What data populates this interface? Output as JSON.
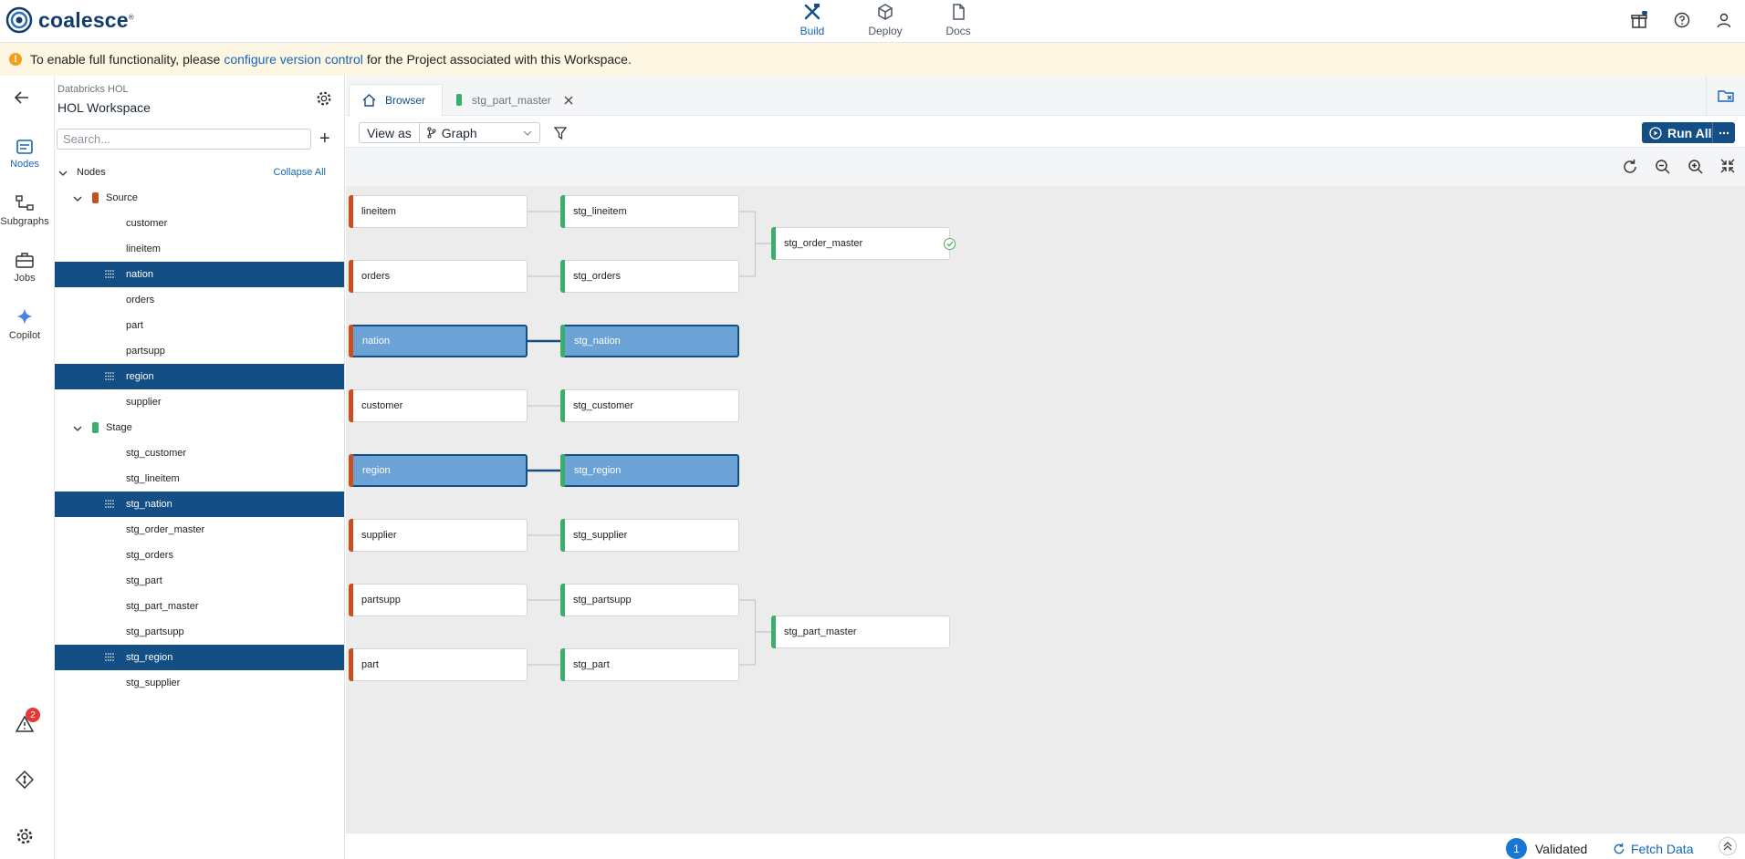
{
  "app": {
    "logo_text": "coalesce",
    "logo_mark": "®"
  },
  "top_nav": [
    {
      "label": "Build",
      "icon": "build-tools-icon",
      "active": true
    },
    {
      "label": "Deploy",
      "icon": "deploy-cube-icon",
      "active": false
    },
    {
      "label": "Docs",
      "icon": "docs-icon",
      "active": false
    }
  ],
  "banner": {
    "icon": "!",
    "text_before": "To enable full functionality, please",
    "link": "configure version control",
    "text_after": "for the Project associated with this Workspace."
  },
  "rail": {
    "items": [
      {
        "label": "Nodes",
        "active": true
      },
      {
        "label": "Subgraphs",
        "active": false
      },
      {
        "label": "Jobs",
        "active": false
      },
      {
        "label": "Copilot",
        "active": false
      }
    ],
    "alert_count": "2"
  },
  "workspace": {
    "org": "Databricks HOL",
    "name": "HOL Workspace"
  },
  "search": {
    "placeholder": "Search..."
  },
  "tree": {
    "root": "Nodes",
    "collapse_all": "Collapse All",
    "groups": [
      {
        "name": "Source",
        "color": "#c9501c",
        "items": [
          {
            "name": "customer",
            "selected": false
          },
          {
            "name": "lineitem",
            "selected": false
          },
          {
            "name": "nation",
            "selected": true
          },
          {
            "name": "orders",
            "selected": false
          },
          {
            "name": "part",
            "selected": false
          },
          {
            "name": "partsupp",
            "selected": false
          },
          {
            "name": "region",
            "selected": true
          },
          {
            "name": "supplier",
            "selected": false
          }
        ]
      },
      {
        "name": "Stage",
        "color": "#3cae6c",
        "items": [
          {
            "name": "stg_customer",
            "selected": false
          },
          {
            "name": "stg_lineitem",
            "selected": false
          },
          {
            "name": "stg_nation",
            "selected": true
          },
          {
            "name": "stg_order_master",
            "selected": false
          },
          {
            "name": "stg_orders",
            "selected": false
          },
          {
            "name": "stg_part",
            "selected": false
          },
          {
            "name": "stg_part_master",
            "selected": false
          },
          {
            "name": "stg_partsupp",
            "selected": false
          },
          {
            "name": "stg_region",
            "selected": true
          },
          {
            "name": "stg_supplier",
            "selected": false
          }
        ]
      }
    ]
  },
  "tabs": [
    {
      "label": "Browser",
      "active": true
    },
    {
      "label": "stg_part_master",
      "active": false,
      "color": "#3cae6c"
    }
  ],
  "toolbar": {
    "view_as_label": "View as",
    "view_as_value": "Graph",
    "run_all": "Run All"
  },
  "graph": {
    "colors": {
      "source": "#c9501c",
      "stage": "#3cae6c",
      "selected_fill": "#6ba3d6",
      "selected_border": "#134e85"
    },
    "nodes": [
      {
        "id": "lineitem",
        "label": "lineitem",
        "kind": "source",
        "selected": false
      },
      {
        "id": "stg_lineitem",
        "label": "stg_lineitem",
        "kind": "stage",
        "selected": false
      },
      {
        "id": "stg_order_master",
        "label": "stg_order_master",
        "kind": "stage",
        "selected": false,
        "validated": true
      },
      {
        "id": "orders",
        "label": "orders",
        "kind": "source",
        "selected": false
      },
      {
        "id": "stg_orders",
        "label": "stg_orders",
        "kind": "stage",
        "selected": false
      },
      {
        "id": "nation",
        "label": "nation",
        "kind": "source",
        "selected": true
      },
      {
        "id": "stg_nation",
        "label": "stg_nation",
        "kind": "stage",
        "selected": true
      },
      {
        "id": "customer",
        "label": "customer",
        "kind": "source",
        "selected": false
      },
      {
        "id": "stg_customer",
        "label": "stg_customer",
        "kind": "stage",
        "selected": false
      },
      {
        "id": "region",
        "label": "region",
        "kind": "source",
        "selected": true
      },
      {
        "id": "stg_region",
        "label": "stg_region",
        "kind": "stage",
        "selected": true
      },
      {
        "id": "supplier",
        "label": "supplier",
        "kind": "source",
        "selected": false
      },
      {
        "id": "stg_supplier",
        "label": "stg_supplier",
        "kind": "stage",
        "selected": false
      },
      {
        "id": "partsupp",
        "label": "partsupp",
        "kind": "source",
        "selected": false
      },
      {
        "id": "stg_partsupp",
        "label": "stg_partsupp",
        "kind": "stage",
        "selected": false
      },
      {
        "id": "stg_part_master",
        "label": "stg_part_master",
        "kind": "stage",
        "selected": false
      },
      {
        "id": "part",
        "label": "part",
        "kind": "source",
        "selected": false
      },
      {
        "id": "stg_part",
        "label": "stg_part",
        "kind": "stage",
        "selected": false
      }
    ],
    "edges": [
      [
        "lineitem",
        "stg_lineitem"
      ],
      [
        "orders",
        "stg_orders"
      ],
      [
        "nation",
        "stg_nation"
      ],
      [
        "customer",
        "stg_customer"
      ],
      [
        "region",
        "stg_region"
      ],
      [
        "supplier",
        "stg_supplier"
      ],
      [
        "partsupp",
        "stg_partsupp"
      ],
      [
        "part",
        "stg_part"
      ],
      [
        "stg_lineitem",
        "stg_order_master"
      ],
      [
        "stg_orders",
        "stg_order_master"
      ],
      [
        "stg_partsupp",
        "stg_part_master"
      ],
      [
        "stg_part",
        "stg_part_master"
      ]
    ]
  },
  "status": {
    "validated_count": "1",
    "validated_label": "Validated",
    "fetch_label": "Fetch Data"
  }
}
